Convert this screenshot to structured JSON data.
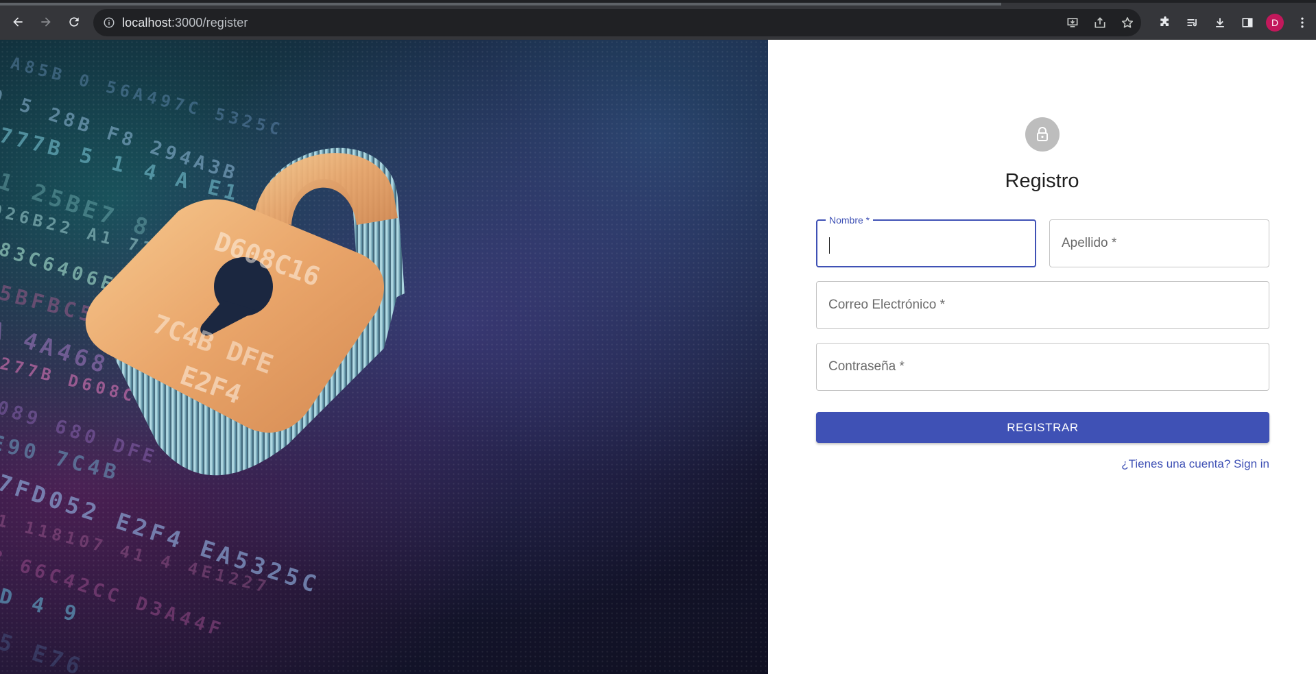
{
  "browser": {
    "url_host": "localhost",
    "url_path": ":3000/register",
    "avatar_initial": "D",
    "icons": [
      "back-icon",
      "forward-icon",
      "reload-icon",
      "site-info-icon",
      "install-app-icon",
      "share-icon",
      "bookmark-star-icon",
      "extensions-icon",
      "reading-list-icon",
      "downloads-icon",
      "side-panel-icon",
      "profile-avatar",
      "more-menu-icon"
    ]
  },
  "hero": {
    "hex_rows": [
      {
        "text": "E  A85B   0   56A497C   5325C",
        "color": "#7fa8d8"
      },
      {
        "text": "  0 5  28B   F8  294A3B",
        "color": "#9ec7e8"
      },
      {
        "text": "777B      5     1  4 A E1",
        "color": "#6fb8c8"
      },
      {
        "text": " D1  25BE7 8      92855",
        "color": "#8fd0d0"
      },
      {
        "text": "926B22     A1     73B  647",
        "color": "#b0e0e0"
      },
      {
        "text": "83C6406E   AB  903   C",
        "color": "#a0d8c8"
      },
      {
        "text": "95BFBC5604   DF  B923589A",
        "color": "#e06aa8"
      },
      {
        "text": "A 4A468 9   053F0",
        "color": "#b080d0"
      },
      {
        "text": " 277B   D608C16  6C7",
        "color": "#d070b0"
      },
      {
        "text": "0089   680     DFE  ",
        "color": "#b080e0"
      },
      {
        "text": "E90   7C4B   ",
        "color": "#6fb0d0"
      },
      {
        "text": "7FD052   E2F4  EA5325C",
        "color": "#90b0e0"
      },
      {
        "text": "  E1   118107  41 4 4E1227",
        "color": "#c070a8"
      },
      {
        "text": "3  66C42CC        D3A44F",
        "color": "#a05090"
      },
      {
        "text": "  D        4 9    ",
        "color": "#60a8c8"
      },
      {
        "text": "      D5      E76    ",
        "color": "#5070a0"
      }
    ]
  },
  "form": {
    "title": "Registro",
    "fields": {
      "first_name": {
        "label": "Nombre *"
      },
      "last_name": {
        "placeholder": "Apellido *"
      },
      "email": {
        "placeholder": "Correo Electrónico *"
      },
      "password": {
        "placeholder": "Contraseña *"
      }
    },
    "submit_label": "REGISTRAR",
    "signin_link": "¿Tienes una cuenta? Sign in"
  },
  "colors": {
    "primary": "#3f51b5",
    "avatar_bg": "#bdbdbd",
    "chrome_bg": "#35363a",
    "profile": "#c2185b"
  }
}
